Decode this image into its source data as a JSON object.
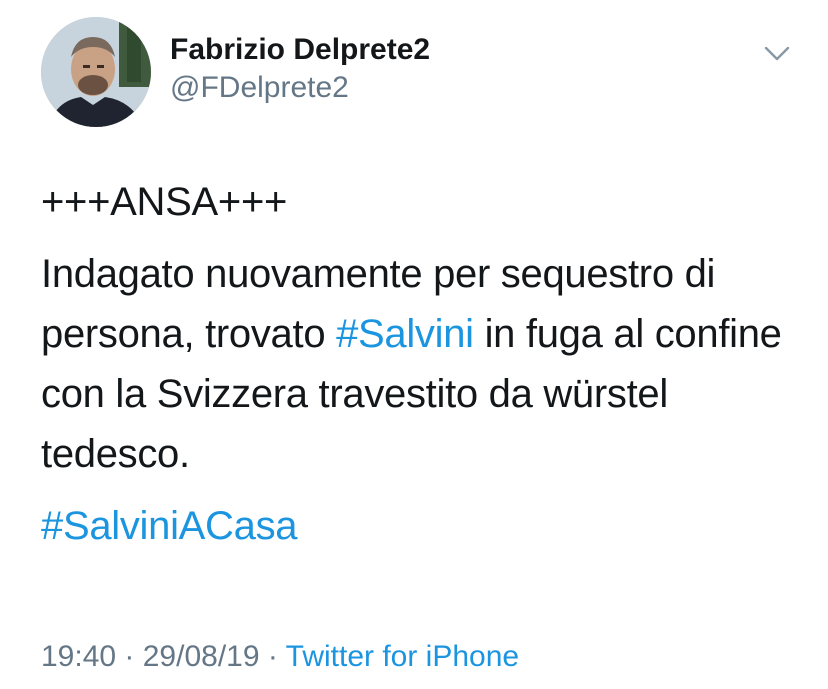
{
  "user": {
    "display_name": "Fabrizio Delprete2",
    "handle": "@FDelprete2",
    "avatar_icon": "profile-photo"
  },
  "menu": {
    "icon": "chevron-down-icon"
  },
  "tweet": {
    "line_header": "+++ANSA+++",
    "para1_part1": "Indagato nuovamente per sequestro di persona, trovato ",
    "hashtag1": "#Salvini",
    "para1_part2": " in fuga al confine con la Svizzera travestito da würstel tedesco.",
    "hashtag2": "#SalviniACasa"
  },
  "meta": {
    "time": "19:40",
    "separator": " · ",
    "date": "29/08/19",
    "source": "Twitter for iPhone"
  },
  "colors": {
    "text": "#14171a",
    "secondary": "#657786",
    "link": "#1b95e0"
  }
}
